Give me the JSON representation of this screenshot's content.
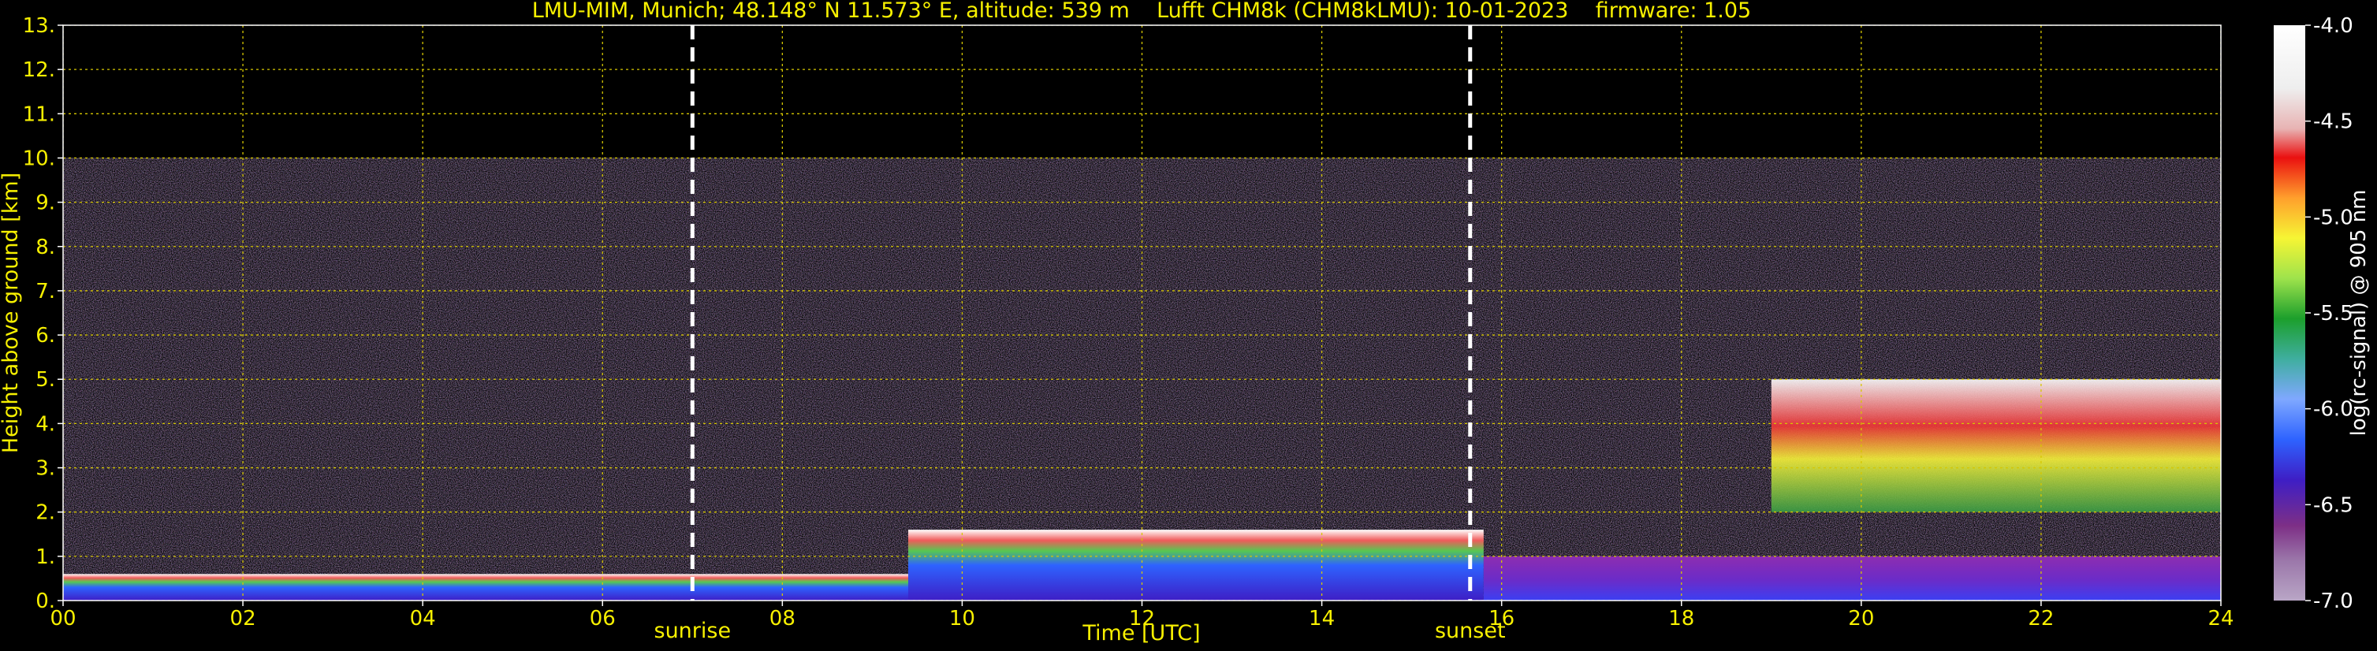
{
  "chart_data": {
    "type": "heatmap",
    "title": "LMU-MIM, Munich; 48.148° N 11.573° E, altitude: 539 m    Lufft CHM8k (CHM8kLMU): 10-01-2023    firmware: 1.05",
    "xlabel": "Time [UTC]",
    "ylabel": "Height above ground [km]",
    "xlim": [
      0,
      24
    ],
    "ylim": [
      0,
      13
    ],
    "x_ticks": [
      "00",
      "02",
      "04",
      "06",
      "08",
      "10",
      "12",
      "14",
      "16",
      "18",
      "20",
      "22",
      "24"
    ],
    "y_ticks": [
      "0.",
      "1.",
      "2.",
      "3.",
      "4.",
      "5.",
      "6.",
      "7.",
      "8.",
      "9.",
      "10.",
      "11.",
      "12.",
      "13."
    ],
    "grid": true,
    "events": [
      {
        "name": "sunrise",
        "time": 7.0
      },
      {
        "name": "sunset",
        "time": 15.65
      }
    ],
    "colorbar": {
      "label": "log(rc-signal) @ 905 nm",
      "min": -7.0,
      "max": -4.0,
      "ticks": [
        "-4.0",
        "-4.5",
        "-5.0",
        "-5.5",
        "-6.0",
        "-6.5",
        "-7.0"
      ]
    },
    "data_ceiling_km": 10.0,
    "features": [
      {
        "name": "boundary-layer",
        "time_start": 0.0,
        "time_end": 9.4,
        "top_km": 0.6
      },
      {
        "name": "boundary-layer",
        "time_start": 9.4,
        "time_end": 15.8,
        "top_km": 1.6
      },
      {
        "name": "residual-layer",
        "time_start": 15.8,
        "time_end": 24.0,
        "top_km": 1.0
      },
      {
        "name": "cloud-layer",
        "time_start": 19.0,
        "time_end": 24.0,
        "base_km": 2.0,
        "top_km": 5.0
      }
    ],
    "colors": {
      "background": "#000000",
      "text": "#f7f000",
      "grid": "#d6c700",
      "event_lines": "#ffffff",
      "noise": "#6d5a8e"
    }
  }
}
